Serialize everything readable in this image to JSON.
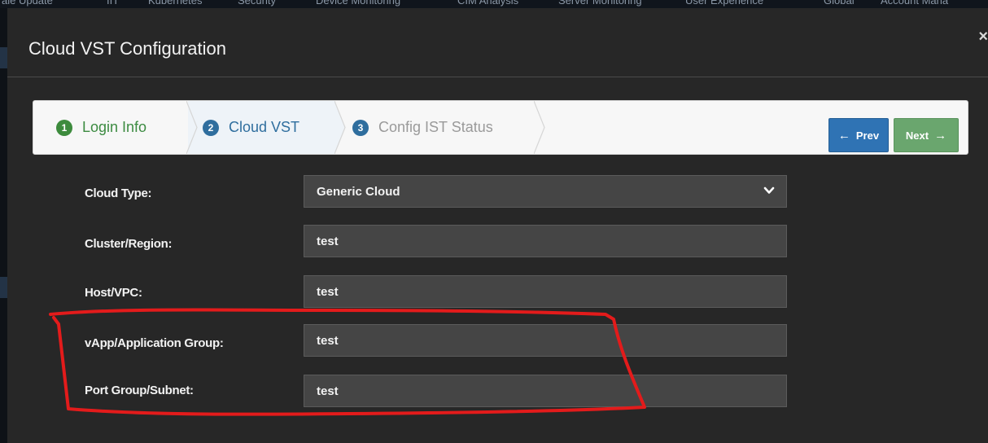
{
  "background_nav": {
    "items": [
      "ale Update",
      "IIT",
      "Kubernetes",
      "Security",
      "Device Monitoring",
      "CIM Analysis",
      "Server Monitoring",
      "User Experience",
      "Global",
      "Account Mana"
    ]
  },
  "modal": {
    "title": "Cloud VST Configuration",
    "close_symbol": "×"
  },
  "wizard": {
    "steps": [
      {
        "number": "1",
        "label": "Login Info",
        "state": "complete",
        "color": "#3d8b3d"
      },
      {
        "number": "2",
        "label": "Cloud VST",
        "state": "active",
        "color": "#2f6e9e"
      },
      {
        "number": "3",
        "label": "Config IST Status",
        "state": "pending",
        "color": "#9a9a9a"
      }
    ],
    "prev_label": "Prev",
    "next_label": "Next"
  },
  "form": {
    "fields": [
      {
        "label": "Cloud Type:",
        "value": "Generic Cloud",
        "type": "select"
      },
      {
        "label": "Cluster/Region:",
        "value": "test",
        "type": "text"
      },
      {
        "label": "Host/VPC:",
        "value": "test",
        "type": "text"
      },
      {
        "label": "vApp/Application Group:",
        "value": "test",
        "type": "text"
      },
      {
        "label": "Port Group/Subnet:",
        "value": "test",
        "type": "text"
      }
    ]
  },
  "annotation": {
    "color": "#e31b1b",
    "marks": "vApp/Application Group and Port Group/Subnet rows"
  }
}
